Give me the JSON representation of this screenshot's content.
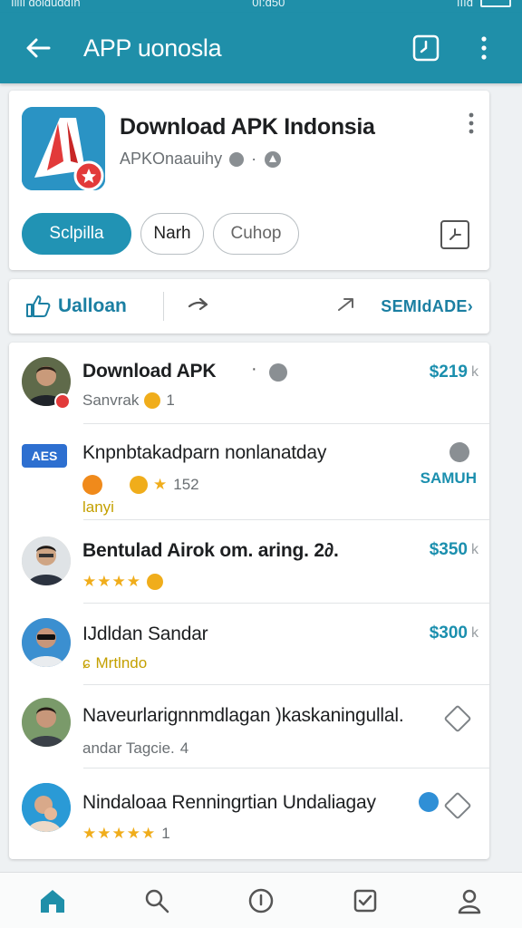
{
  "statusbar": {
    "left": "Illıl ɑolɑuɑɑın",
    "center": "0ı:ɑ50",
    "right": "ıııɑ"
  },
  "appbar": {
    "title": "APP uonosla"
  },
  "app": {
    "name": "Download APK Indonsia",
    "developer": "APKOnaauihy",
    "chips": [
      "Sclpilla",
      "Narh",
      "Cuhop"
    ]
  },
  "actions": {
    "like_label": "Ualloan",
    "more_label": "SEMIdADE›"
  },
  "items": [
    {
      "title": "Download APK",
      "sub": "Sanvrak",
      "sub_count": "1",
      "price": "$219",
      "price_mark": "k"
    },
    {
      "badge": "AES",
      "title": "Knpnbtakadparn nonlanatday",
      "sub_count": "152",
      "extra": "lanyi",
      "price": "SAMUH"
    },
    {
      "title": "Bentulad Airok om. aring. 2∂.",
      "price": "$350",
      "price_mark": "k"
    },
    {
      "title": "IJdldan Sandar",
      "sub": "Mrtlndo",
      "sub_prefix": "ɕ",
      "price": "$300",
      "price_mark": "k"
    },
    {
      "title": "Naveurlarignnmdlagan )kaskaningullal.",
      "sub": "andar Tagcie.",
      "sub_count": "4"
    },
    {
      "title": "Nindaloaa Renningrtian Undaliagay",
      "sub_count": "1"
    }
  ],
  "colors": {
    "primary": "#1f8fa9",
    "accent": "#1b8fae",
    "star": "#f0ad1b"
  }
}
